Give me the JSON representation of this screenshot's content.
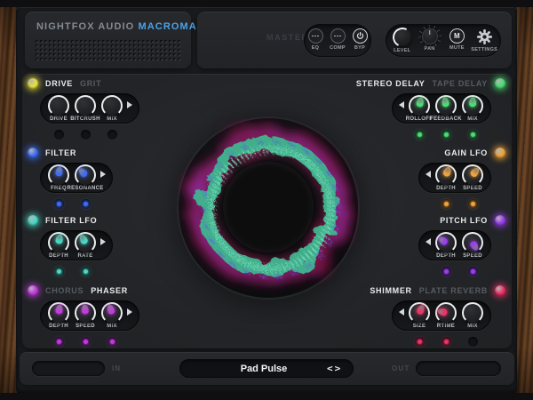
{
  "brand": {
    "maker": "NIGHTFOX AUDIO",
    "product": "MACROMACRO",
    "accent": "#4aa3e8"
  },
  "master": {
    "label": "MASTER",
    "toggles": [
      {
        "label": "EQ",
        "icon": "dots-icon"
      },
      {
        "label": "COMP",
        "icon": "dots-icon"
      },
      {
        "label": "BYP",
        "icon": "power-icon"
      }
    ],
    "controls": [
      {
        "label": "LEVEL",
        "type": "knob"
      },
      {
        "label": "PAN",
        "type": "knob"
      },
      {
        "label": "MUTE",
        "type": "button",
        "glyph": "M"
      },
      {
        "label": "SETTINGS",
        "type": "button",
        "icon": "gear-icon"
      }
    ]
  },
  "sections": [
    {
      "id": "drive",
      "side": "left",
      "accent": "#e8e23c",
      "titles": [
        {
          "text": "DRIVE",
          "active": true
        },
        {
          "text": "GRIT",
          "active": false
        }
      ],
      "knobs": [
        {
          "label": "DRIVE"
        },
        {
          "label": "BITCRUSH"
        },
        {
          "label": "MIX"
        }
      ],
      "sub_leds": [
        "off",
        "off",
        "off"
      ],
      "arrow": "right"
    },
    {
      "id": "filter",
      "side": "left",
      "accent": "#3f6cf5",
      "titles": [
        {
          "text": "FILTER",
          "active": true
        }
      ],
      "knobs": [
        {
          "label": "FREQ",
          "rot": 8
        },
        {
          "label": "RESONANCE",
          "rot": -42
        }
      ],
      "sub_leds": [
        "on",
        "on"
      ],
      "arrow": "right"
    },
    {
      "id": "filter-lfo",
      "side": "left",
      "accent": "#46d9c5",
      "titles": [
        {
          "text": "FILTER LFO",
          "active": true
        }
      ],
      "knobs": [
        {
          "label": "DEPTH",
          "rot": 12
        },
        {
          "label": "RATE",
          "rot": -30
        }
      ],
      "sub_leds": [
        "on",
        "on"
      ],
      "arrow": "right"
    },
    {
      "id": "phaser",
      "side": "left",
      "accent": "#c438e0",
      "titles": [
        {
          "text": "CHORUS",
          "active": false
        },
        {
          "text": "PHASER",
          "active": true
        }
      ],
      "knobs": [
        {
          "label": "DEPTH",
          "rot": 10
        },
        {
          "label": "SPEED",
          "rot": -4
        },
        {
          "label": "MIX",
          "rot": -18
        }
      ],
      "sub_leds": [
        "on",
        "on",
        "on"
      ],
      "arrow": "right"
    },
    {
      "id": "stereo-delay",
      "side": "right",
      "accent": "#4ade72",
      "titles": [
        {
          "text": "STEREO DELAY",
          "active": true
        },
        {
          "text": "TAPE DELAY",
          "active": false
        }
      ],
      "knobs": [
        {
          "label": "ROLLOFF",
          "rot": 14
        },
        {
          "label": "FEEDBACK",
          "rot": -8
        },
        {
          "label": "MIX",
          "rot": 2
        }
      ],
      "sub_leds": [
        "on",
        "on",
        "on"
      ],
      "arrow": "left"
    },
    {
      "id": "gain-lfo",
      "side": "right",
      "accent": "#f2a338",
      "titles": [
        {
          "text": "GAIN LFO",
          "active": true
        }
      ],
      "knobs": [
        {
          "label": "DEPTH",
          "rot": 22
        },
        {
          "label": "SPEED",
          "rot": 40
        }
      ],
      "sub_leds": [
        "on",
        "on"
      ],
      "arrow": "left"
    },
    {
      "id": "pitch-lfo",
      "side": "right",
      "accent": "#9a3df0",
      "titles": [
        {
          "text": "PITCH LFO",
          "active": true
        }
      ],
      "knobs": [
        {
          "label": "DEPTH",
          "rot": -55
        },
        {
          "label": "SPEED",
          "rot": 150
        }
      ],
      "sub_leds": [
        "on",
        "on"
      ],
      "arrow": "left"
    },
    {
      "id": "shimmer",
      "side": "right",
      "accent": "#f03066",
      "titles": [
        {
          "text": "SHIMMER",
          "active": true
        },
        {
          "text": "PLATE REVERB",
          "active": false
        }
      ],
      "knobs": [
        {
          "label": "SIZE",
          "rot": 25
        },
        {
          "label": "RTIME",
          "rot": -75
        },
        {
          "label": "MIX"
        }
      ],
      "sub_leds": [
        "on",
        "on",
        "off"
      ],
      "arrow": "left"
    }
  ],
  "visualizer": {
    "base": "#0d0e10",
    "magenta": "#d4176b",
    "purple": "#a43ff0",
    "teal": "#3fb68f",
    "teal_bright": "#7debc6",
    "blue": "#5a58f0"
  },
  "preset": {
    "name": "Pad Pulse",
    "nav": "<>"
  },
  "io": {
    "in": "IN",
    "out": "OUT"
  }
}
